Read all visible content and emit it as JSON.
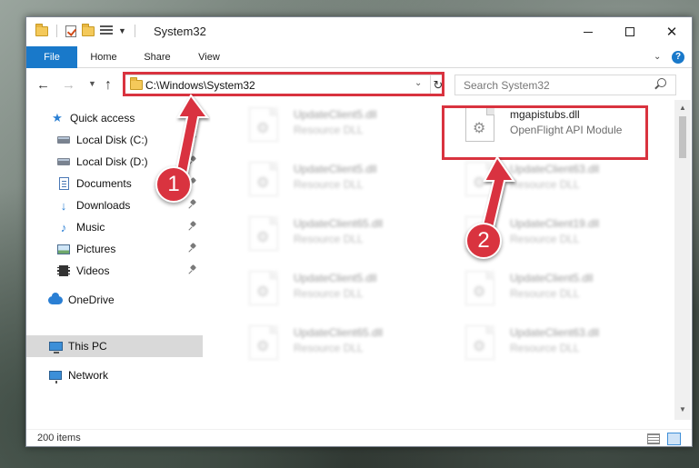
{
  "window": {
    "title": "System32"
  },
  "ribbon": {
    "tabs": [
      "File",
      "Home",
      "Share",
      "View"
    ],
    "help_label": "?"
  },
  "navigation": {
    "address": "C:\\Windows\\System32",
    "search_placeholder": "Search System32"
  },
  "sidebar": {
    "items": [
      {
        "label": "Quick access",
        "icon": "star-icon",
        "pinned": false
      },
      {
        "label": "Local Disk (C:)",
        "icon": "disk-icon",
        "pinned": true
      },
      {
        "label": "Local Disk (D:)",
        "icon": "disk-icon",
        "pinned": true
      },
      {
        "label": "Documents",
        "icon": "documents-icon",
        "pinned": true
      },
      {
        "label": "Downloads",
        "icon": "downloads-icon",
        "pinned": true
      },
      {
        "label": "Music",
        "icon": "music-icon",
        "pinned": true
      },
      {
        "label": "Pictures",
        "icon": "pictures-icon",
        "pinned": true
      },
      {
        "label": "Videos",
        "icon": "videos-icon",
        "pinned": true
      },
      {
        "label": "OneDrive",
        "icon": "onedrive-icon",
        "pinned": false
      },
      {
        "label": "This PC",
        "icon": "this-pc-icon",
        "pinned": false,
        "selected": true
      },
      {
        "label": "Network",
        "icon": "network-icon",
        "pinned": false
      }
    ]
  },
  "files": {
    "featured": {
      "name": "mgapistubs.dll",
      "type": "OpenFlight API Module"
    },
    "blurred": [
      {
        "name": "UpdateClient5.dll",
        "type": "Resource DLL"
      },
      {
        "name": "UpdateClient5.dll",
        "type": "Resource DLL"
      },
      {
        "name": "UpdateClient63.dll",
        "type": "Resource DLL"
      },
      {
        "name": "UpdateClient65.dll",
        "type": "Resource DLL"
      },
      {
        "name": "UpdateClient19.dll",
        "type": "Resource DLL"
      },
      {
        "name": "UpdateClient5.dll",
        "type": "Resource DLL"
      },
      {
        "name": "UpdateClient5.dll",
        "type": "Resource DLL"
      },
      {
        "name": "UpdateClient65.dll",
        "type": "Resource DLL"
      },
      {
        "name": "UpdateClient63.dll",
        "type": "Resource DLL"
      }
    ]
  },
  "status": {
    "item_count": "200 items"
  },
  "annotations": {
    "step1": "1",
    "step2": "2",
    "color": "#d9333f"
  }
}
